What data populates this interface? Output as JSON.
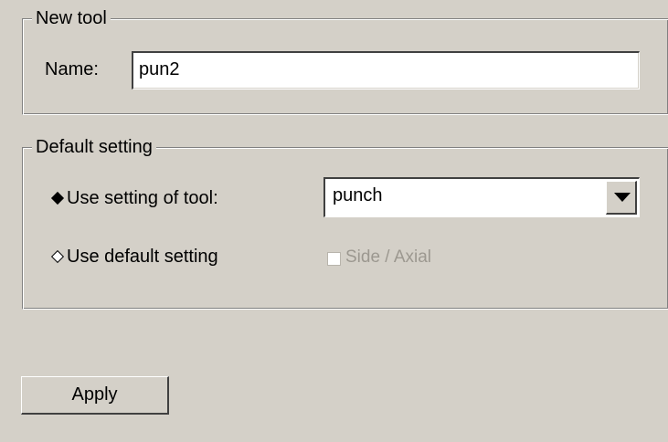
{
  "new_tool": {
    "legend": "New tool",
    "name_label": "Name:",
    "name_value": "pun2"
  },
  "default_setting": {
    "legend": "Default setting",
    "use_tool_label": "Use setting of tool:",
    "use_tool_checked": true,
    "tool_select_value": "punch",
    "use_default_label": "Use default setting",
    "use_default_checked": false,
    "side_axial_label": "Side / Axial",
    "side_axial_checked": false,
    "side_axial_enabled": false
  },
  "apply_label": "Apply",
  "colors": {
    "background": "#d4d0c8",
    "disabled_text": "#9c9890"
  }
}
